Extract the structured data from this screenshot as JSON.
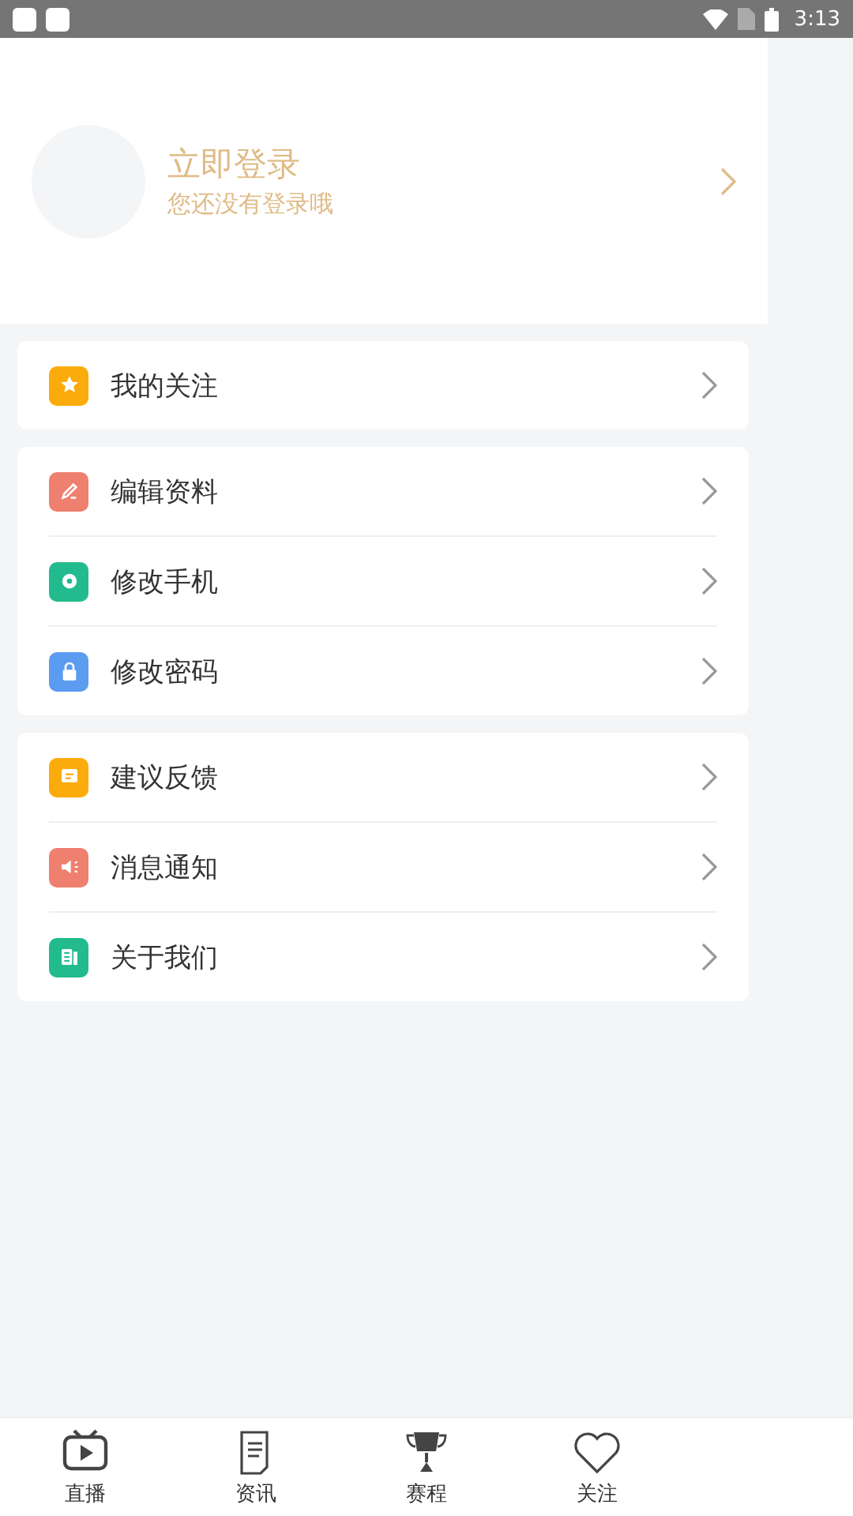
{
  "status_bar": {
    "time": "3:13"
  },
  "profile": {
    "title": "立即登录",
    "subtitle": "您还没有登录哦"
  },
  "menu_groups": [
    {
      "items": [
        {
          "label": "我的关注",
          "color": "#fbab0b"
        }
      ]
    },
    {
      "items": [
        {
          "label": "编辑资料",
          "color": "#ef7f6e"
        },
        {
          "label": "修改手机",
          "color": "#22bb8e"
        },
        {
          "label": "修改密码",
          "color": "#5b9cf0"
        }
      ]
    },
    {
      "items": [
        {
          "label": "建议反馈",
          "color": "#fbab0b"
        },
        {
          "label": "消息通知",
          "color": "#ef7f6e"
        },
        {
          "label": "关于我们",
          "color": "#22bb8e"
        }
      ]
    }
  ],
  "tab_bar": [
    {
      "label": "直播",
      "selected": false
    },
    {
      "label": "资讯",
      "selected": false
    },
    {
      "label": "赛程",
      "selected": false
    },
    {
      "label": "关注",
      "selected": false
    }
  ]
}
